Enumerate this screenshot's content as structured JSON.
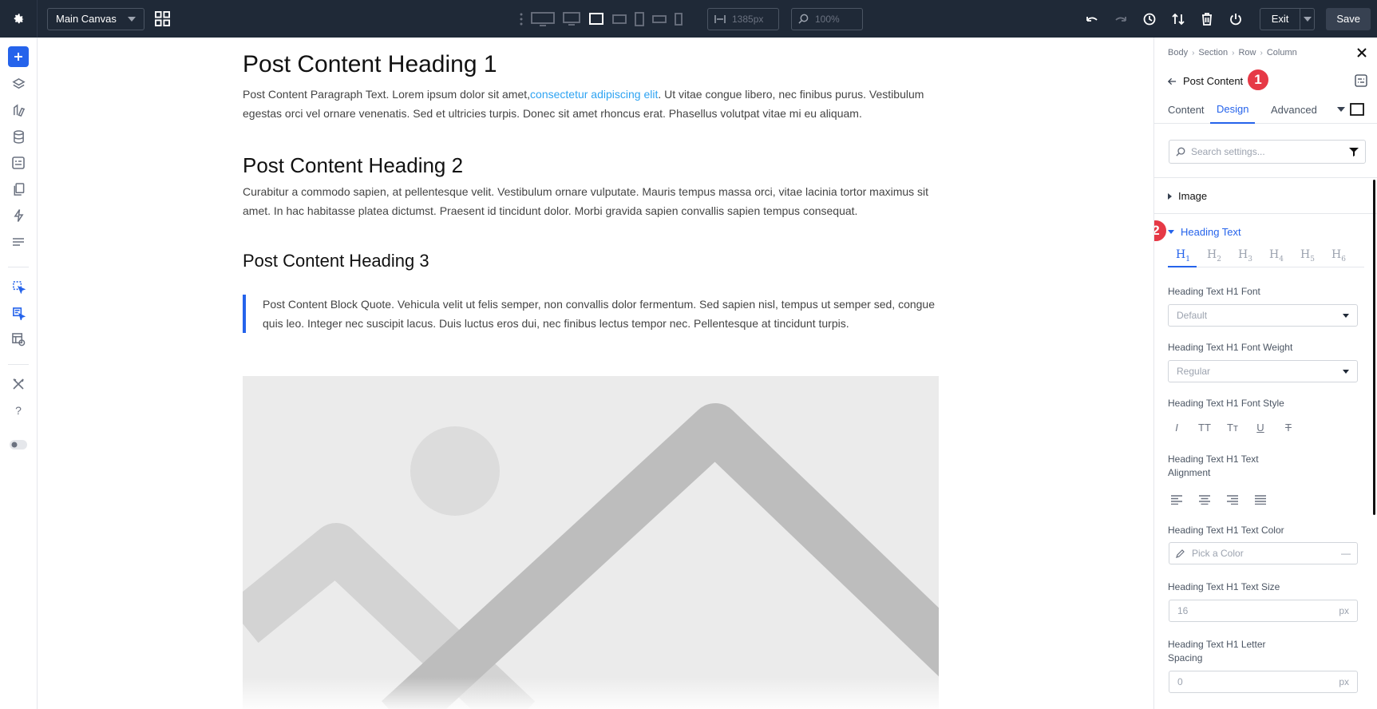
{
  "topbar": {
    "canvas_select": "Main Canvas",
    "width_value": "1385px",
    "zoom_value": "100%",
    "exit_label": "Exit",
    "save_label": "Save"
  },
  "content": {
    "heading1": "Post Content Heading 1",
    "para1_a": "Post Content Paragraph Text. Lorem ipsum dolor sit amet,",
    "para1_link": "consectetur adipiscing elit",
    "para1_b": ". Ut vitae congue libero, nec finibus purus. Vestibulum egestas orci vel ornare venenatis. Sed et ultricies turpis. Donec sit amet rhoncus erat. Phasellus volutpat vitae mi eu aliquam.",
    "heading2": "Post Content Heading 2",
    "para2": "Curabitur a commodo sapien, at pellentesque velit. Vestibulum ornare vulputate. Mauris tempus massa orci, vitae lacinia tortor maximus sit amet. In hac habitasse platea dictumst. Praesent id tincidunt dolor. Morbi gravida sapien convallis sapien tempus consequat.",
    "heading3": "Post Content Heading 3",
    "quote": "Post Content Block Quote. Vehicula velit ut felis semper, non convallis dolor fermentum. Sed sapien nisl, tempus ut semper sed, congue quis leo. Integer nec suscipit lacus. Duis luctus eros dui, nec finibus lectus tempor nec. Pellentesque at tincidunt turpis."
  },
  "panel": {
    "breadcrumb": [
      "Body",
      "Section",
      "Row",
      "Column"
    ],
    "module_title": "Post Content",
    "badge1": "1",
    "badge2": "2",
    "tabs": [
      "Content",
      "Design",
      "Advanced"
    ],
    "search_placeholder": "Search settings...",
    "groups": {
      "image": "Image",
      "heading_text": "Heading Text"
    },
    "heading_levels": [
      "H",
      "H",
      "H",
      "H",
      "H",
      "H"
    ],
    "heading_level_subs": [
      "1",
      "2",
      "3",
      "4",
      "5",
      "6"
    ],
    "fields": {
      "font_label": "Heading Text H1 Font",
      "font_value": "Default",
      "weight_label": "Heading Text H1 Font Weight",
      "weight_value": "Regular",
      "style_label": "Heading Text H1 Font Style",
      "align_label_1": "Heading Text H1 Text",
      "align_label_2": "Alignment",
      "color_label": "Heading Text H1 Text Color",
      "color_placeholder": "Pick a Color",
      "color_dash": "—",
      "size_label": "Heading Text H1 Text Size",
      "size_value": "16",
      "size_unit": "px",
      "spacing_label_1": "Heading Text H1 Letter",
      "spacing_label_2": "Spacing",
      "spacing_value": "0",
      "spacing_unit": "px"
    },
    "style_buttons": [
      "I",
      "TT",
      "Tт",
      "U",
      "T"
    ]
  },
  "colors": {
    "accent": "#2563eb",
    "badge": "#e63946",
    "topbar": "#1f2937",
    "link": "#2ea3f2"
  }
}
